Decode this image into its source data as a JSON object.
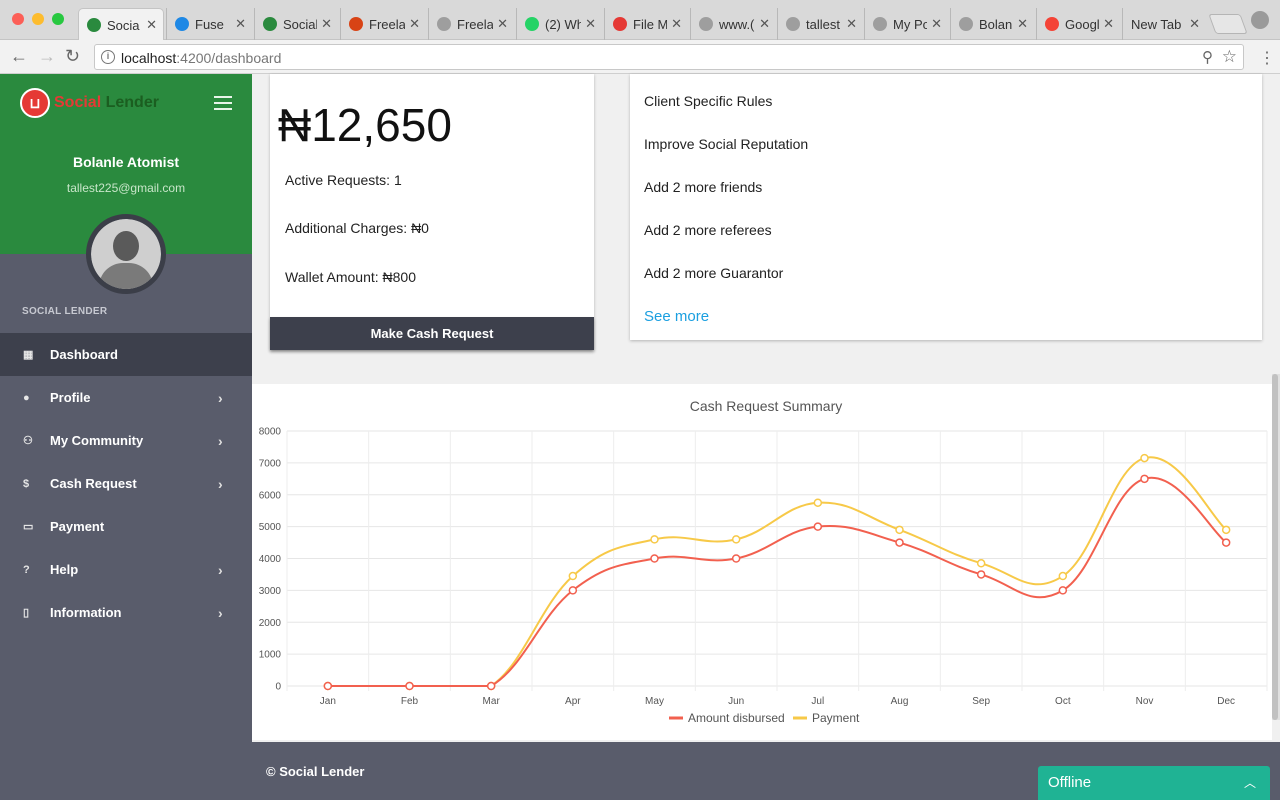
{
  "browser": {
    "tabs": [
      {
        "title": "Socia",
        "active": true,
        "favicon_color": "#2a8a3e"
      },
      {
        "title": "Fuse",
        "active": false,
        "favicon_color": "#1e88e5"
      },
      {
        "title": "Social",
        "active": false,
        "favicon_color": "#2a8a3e"
      },
      {
        "title": "Freela",
        "active": false,
        "favicon_color": "#d84315"
      },
      {
        "title": "Freela",
        "active": false,
        "favicon_color": "#9e9e9e"
      },
      {
        "title": "(2) Wh",
        "active": false,
        "favicon_color": "#25d366"
      },
      {
        "title": "File M",
        "active": false,
        "favicon_color": "#e53935"
      },
      {
        "title": "www.(",
        "active": false,
        "favicon_color": "#9e9e9e"
      },
      {
        "title": "tallest",
        "active": false,
        "favicon_color": "#9e9e9e"
      },
      {
        "title": "My Po",
        "active": false,
        "favicon_color": "#9e9e9e"
      },
      {
        "title": "Bolanl",
        "active": false,
        "favicon_color": "#9e9e9e"
      },
      {
        "title": "Googl",
        "active": false,
        "favicon_color": "#f44336"
      },
      {
        "title": "New Tab",
        "active": false,
        "favicon_color": ""
      }
    ],
    "url_host": "localhost",
    "url_rest": ":4200/dashboard"
  },
  "sidebar": {
    "logo_word1": "Social",
    "logo_word2": "Lender",
    "user_name": "Bolanle Atomist",
    "user_email": "tallest225@gmail.com",
    "section_label": "SOCIAL LENDER",
    "items": [
      {
        "label": "Dashboard",
        "icon": "dashboard-icon",
        "active": true,
        "has_chevron": false
      },
      {
        "label": "Profile",
        "icon": "person-icon",
        "active": false,
        "has_chevron": true
      },
      {
        "label": "My Community",
        "icon": "people-icon",
        "active": false,
        "has_chevron": true
      },
      {
        "label": "Cash Request",
        "icon": "money-icon",
        "active": false,
        "has_chevron": true
      },
      {
        "label": "Payment",
        "icon": "credit-card-icon",
        "active": false,
        "has_chevron": false
      },
      {
        "label": "Help",
        "icon": "help-icon",
        "active": false,
        "has_chevron": true
      },
      {
        "label": "Information",
        "icon": "info-icon",
        "active": false,
        "has_chevron": true
      }
    ]
  },
  "summary_card": {
    "amount": "₦12,650",
    "active_requests": "Active Requests: 1",
    "additional_charges": "Additional Charges: ₦0",
    "wallet_amount": "Wallet Amount: ₦800",
    "button_label": "Make Cash Request"
  },
  "rules_card": {
    "items": [
      "Client Specific Rules",
      "Improve Social Reputation",
      "Add 2 more friends",
      "Add 2 more referees",
      "Add 2 more Guarantor"
    ],
    "see_more": "See more"
  },
  "chart_data": {
    "type": "line",
    "title": "Cash Request Summary",
    "categories": [
      "Jan",
      "Feb",
      "Mar",
      "Apr",
      "May",
      "Jun",
      "Jul",
      "Aug",
      "Sep",
      "Oct",
      "Nov",
      "Dec"
    ],
    "series": [
      {
        "name": "Amount disbursed",
        "color": "#f2604f",
        "values": [
          0,
          0,
          0,
          3000,
          4000,
          4000,
          5000,
          4500,
          3500,
          3000,
          6500,
          4500
        ]
      },
      {
        "name": "Payment",
        "color": "#f7c948",
        "values": [
          0,
          0,
          0,
          3450,
          4600,
          4600,
          5750,
          4900,
          3850,
          3450,
          7150,
          4900
        ]
      }
    ],
    "ylim": [
      0,
      8000
    ],
    "yticks": [
      0,
      1000,
      2000,
      3000,
      4000,
      5000,
      6000,
      7000,
      8000
    ],
    "grid": true,
    "legend_position": "bottom"
  },
  "footer": {
    "text": "© Social Lender"
  },
  "chat": {
    "label": "Offline"
  }
}
